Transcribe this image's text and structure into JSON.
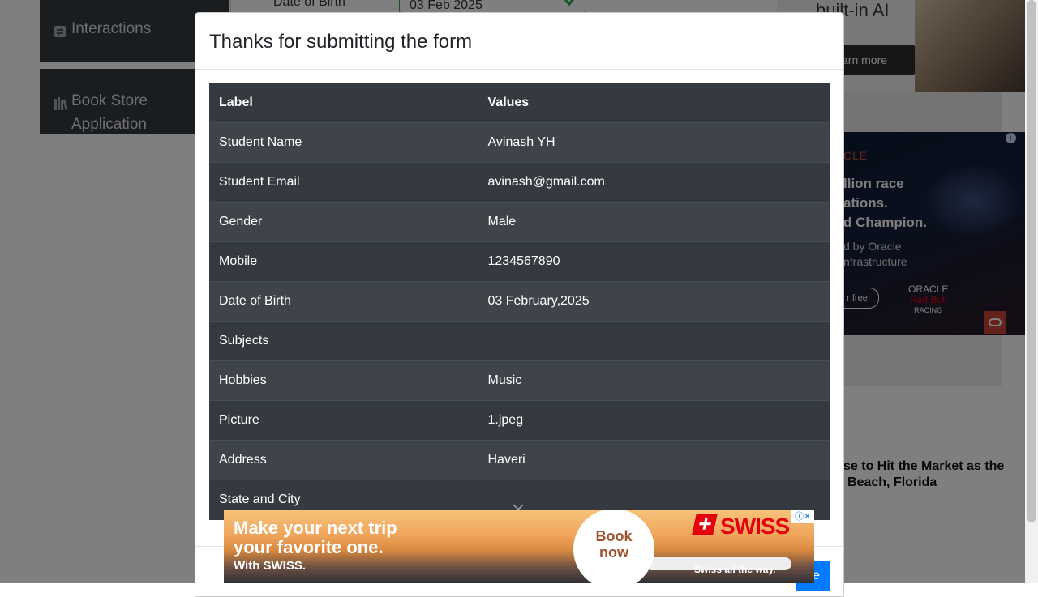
{
  "background": {
    "sidebar": {
      "groups": [
        {
          "label": "Interactions",
          "icon": "interactions-icon"
        },
        {
          "label": "Book Store\nApplication",
          "label_line1": "Book Store",
          "label_line2": "Application",
          "icon": "book-icon"
        }
      ]
    },
    "form": {
      "dob_label": "Date of Birth",
      "dob_value": "03 Feb 2025"
    },
    "ads": {
      "top_text": "built-in AI",
      "top_button": "arn more",
      "oracle_brand": "CLE",
      "oracle_line1": "llion race",
      "oracle_line2": "ations.",
      "oracle_line3": "d Champion.",
      "oracle_line4": "d by Oracle",
      "oracle_line5": "nfrastructure",
      "oracle_button": "r free",
      "oracle_logo_1": "ORACLE",
      "oracle_logo_2": "Red Bull",
      "oracle_logo_3": "RACING",
      "news_line1": "se to Hit the Market as the",
      "news_line2": "Beach, Florida"
    }
  },
  "modal": {
    "title": "Thanks for submitting the form",
    "table": {
      "headers": [
        "Label",
        "Values"
      ],
      "rows": [
        {
          "label": "Student Name",
          "value": "Avinash YH"
        },
        {
          "label": "Student Email",
          "value": "avinash@gmail.com"
        },
        {
          "label": "Gender",
          "value": "Male"
        },
        {
          "label": "Mobile",
          "value": "1234567890"
        },
        {
          "label": "Date of Birth",
          "value": "03 February,2025"
        },
        {
          "label": "Subjects",
          "value": ""
        },
        {
          "label": "Hobbies",
          "value": "Music"
        },
        {
          "label": "Picture",
          "value": "1.jpeg"
        },
        {
          "label": "Address",
          "value": "Haveri"
        },
        {
          "label": "State and City",
          "value": ""
        }
      ]
    },
    "close_label": "e"
  },
  "swiss_ad": {
    "headline_line1": "Make your next trip",
    "headline_line2": "your favorite one.",
    "sub": "With SWISS.",
    "book_line1": "Book",
    "book_line2": "now",
    "brand": "SWISS",
    "tagline": "Swiss   all    the   way."
  },
  "colors": {
    "sidebar_bg": "#343a40",
    "table_dark": "#343a40",
    "table_stripe": "#3e444a",
    "primary": "#007bff",
    "success": "#28a745",
    "swiss_red": "#e3000f"
  }
}
